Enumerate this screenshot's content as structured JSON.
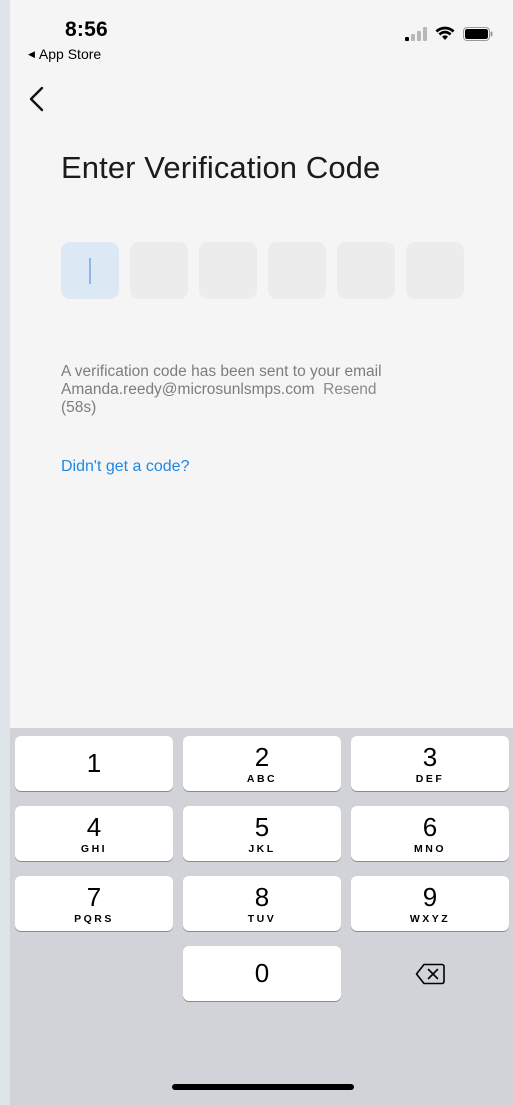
{
  "status_bar": {
    "time": "8:56",
    "back_app_label": "App Store"
  },
  "page": {
    "title": "Enter Verification Code",
    "code_boxes": 6,
    "info_line1": "A verification code has been sent to your email",
    "email": "Amanda.reedy@microsunlsmps.com",
    "resend_label": "Resend",
    "resend_countdown": "(58s)",
    "help_link": "Didn't get a code?"
  },
  "keyboard": {
    "keys": [
      {
        "digit": "1",
        "letters": ""
      },
      {
        "digit": "2",
        "letters": "ABC"
      },
      {
        "digit": "3",
        "letters": "DEF"
      },
      {
        "digit": "4",
        "letters": "GHI"
      },
      {
        "digit": "5",
        "letters": "JKL"
      },
      {
        "digit": "6",
        "letters": "MNO"
      },
      {
        "digit": "7",
        "letters": "PQRS"
      },
      {
        "digit": "8",
        "letters": "TUV"
      },
      {
        "digit": "9",
        "letters": "WXYZ"
      },
      {
        "digit": "0",
        "letters": ""
      }
    ]
  },
  "colors": {
    "accent": "#1e88e5",
    "active_box": "#dde8f5"
  }
}
